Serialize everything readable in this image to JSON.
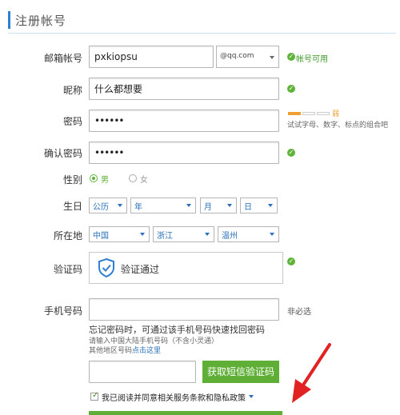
{
  "header": {
    "title": "注册帐号"
  },
  "email": {
    "label": "邮箱帐号",
    "value": "pxkiopsu",
    "domain": "@qq.com",
    "status": "帐号可用"
  },
  "nickname": {
    "label": "昵称",
    "value": "什么都想要"
  },
  "password": {
    "label": "密码",
    "value": "••••••",
    "strength_label": "弱",
    "hint": "试试字母、数字、标点的组合吧"
  },
  "confirm_password": {
    "label": "确认密码",
    "value": "••••••"
  },
  "gender": {
    "label": "性别",
    "options": [
      "男",
      "女"
    ],
    "selected": "男"
  },
  "birthday": {
    "label": "生日",
    "calendar": "公历",
    "year": "年",
    "month": "月",
    "day": "日"
  },
  "location": {
    "label": "所在地",
    "country": "中国",
    "province": "浙江",
    "city": "温州"
  },
  "captcha": {
    "label": "验证码",
    "status": "验证通过"
  },
  "phone": {
    "label": "手机号码",
    "value": "",
    "optional": "非必选",
    "info": "忘记密码时，可通过该手机号码快速找回密码",
    "hint1": "请输入中国大陆手机号码（不含小灵通）",
    "hint2_prefix": "其他地区号码",
    "hint2_link": "点击这里"
  },
  "sms": {
    "value": "",
    "button": "获取短信验证码"
  },
  "agreement": {
    "text": "我已阅读并同意相关服务条款和隐私政策"
  },
  "colors": {
    "accent": "#2f7fd3",
    "ok": "#5fb33a",
    "button": "#5fae35",
    "annotation_arrow": "#e02222"
  }
}
